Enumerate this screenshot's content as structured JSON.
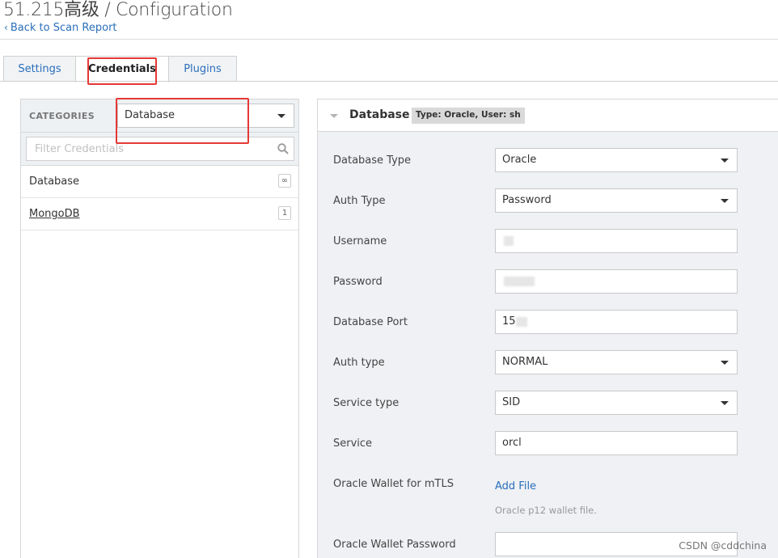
{
  "header": {
    "title": "51.215高级 / Configuration",
    "back_link": "Back to Scan Report"
  },
  "tabs": [
    {
      "label": "Settings",
      "active": false
    },
    {
      "label": "Credentials",
      "active": true
    },
    {
      "label": "Plugins",
      "active": false
    }
  ],
  "sidebar": {
    "categories_label": "CATEGORIES",
    "category_selected": "Database",
    "filter_placeholder": "Filter Credentials",
    "items": [
      {
        "label": "Database",
        "badge": "∞"
      },
      {
        "label": "MongoDB",
        "badge": "1"
      }
    ]
  },
  "panel": {
    "title": "Database",
    "type_badge": "Type: Oracle, User: sh",
    "fields": {
      "database_type": {
        "label": "Database Type",
        "value": "Oracle"
      },
      "auth_type": {
        "label": "Auth Type",
        "value": "Password"
      },
      "username": {
        "label": "Username",
        "value": ""
      },
      "password": {
        "label": "Password",
        "value": ""
      },
      "database_port": {
        "label": "Database Port",
        "value": "15"
      },
      "auth_type2": {
        "label": "Auth type",
        "value": "NORMAL"
      },
      "service_type": {
        "label": "Service type",
        "value": "SID"
      },
      "service": {
        "label": "Service",
        "value": "orcl"
      },
      "oracle_wallet": {
        "label": "Oracle Wallet for mTLS",
        "add_file": "Add File",
        "help": "Oracle p12 wallet file."
      },
      "wallet_password": {
        "label": "Oracle Wallet Password",
        "value": ""
      }
    }
  },
  "watermark": "CSDN @cddchina",
  "colors": {
    "accent": "#2a6ebb",
    "highlight": "#e53935",
    "panel_bg": "#eff1f4"
  }
}
